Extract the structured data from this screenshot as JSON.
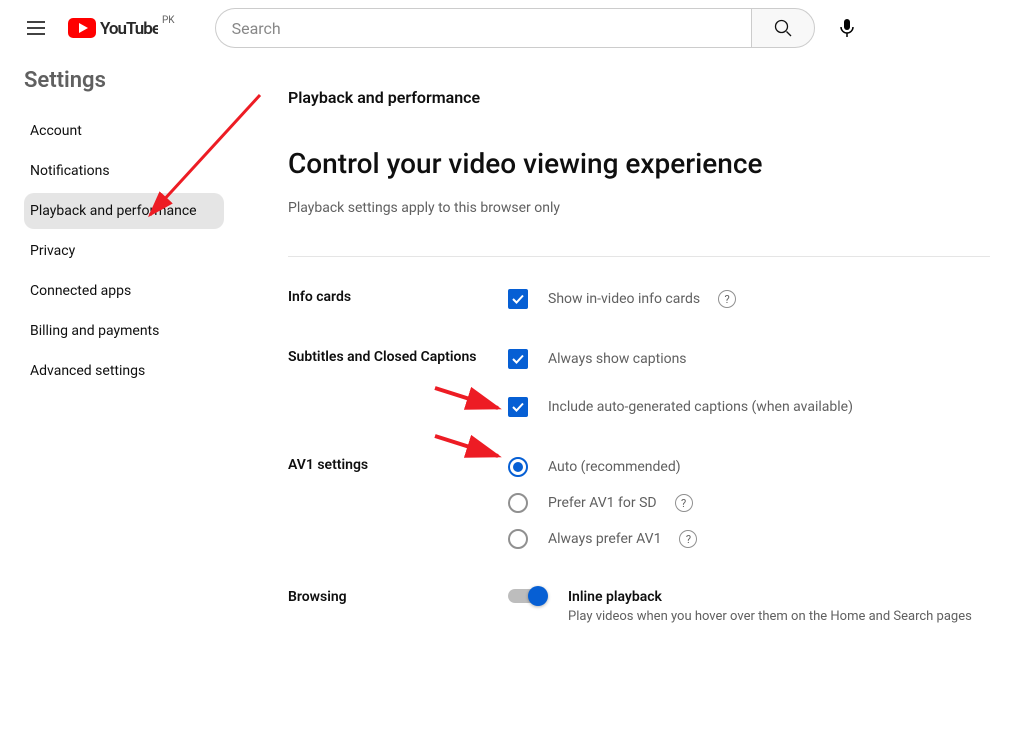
{
  "header": {
    "country_code": "PK",
    "search_placeholder": "Search"
  },
  "sidebar": {
    "title": "Settings",
    "items": [
      {
        "label": "Account"
      },
      {
        "label": "Notifications"
      },
      {
        "label": "Playback and performance"
      },
      {
        "label": "Privacy"
      },
      {
        "label": "Connected apps"
      },
      {
        "label": "Billing and payments"
      },
      {
        "label": "Advanced settings"
      }
    ],
    "active_index": 2
  },
  "main": {
    "breadcrumb": "Playback and performance",
    "title": "Control your video viewing experience",
    "description": "Playback settings apply to this browser only",
    "sections": {
      "info_cards": {
        "label": "Info cards",
        "option": "Show in-video info cards"
      },
      "subtitles": {
        "label": "Subtitles and Closed Captions",
        "opt1": "Always show captions",
        "opt2": "Include auto-generated captions (when available)"
      },
      "av1": {
        "label": "AV1 settings",
        "opt1": "Auto (recommended)",
        "opt2": "Prefer AV1 for SD",
        "opt3": "Always prefer AV1"
      },
      "browsing": {
        "label": "Browsing",
        "toggle_title": "Inline playback",
        "toggle_desc": "Play videos when you hover over them on the Home and Search pages"
      }
    }
  }
}
